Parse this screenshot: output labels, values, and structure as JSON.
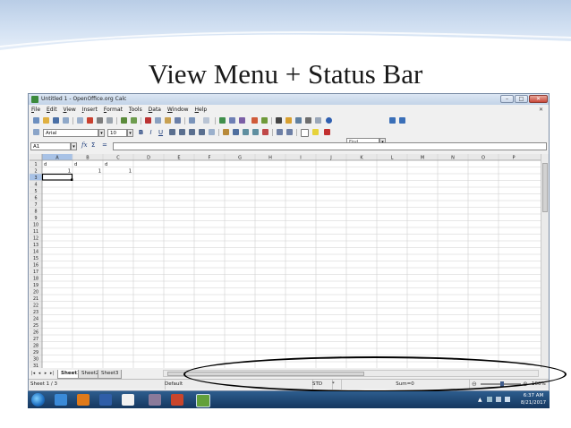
{
  "slide": {
    "title": "View Menu + Status Bar"
  },
  "window": {
    "title": "Untitled 1 - OpenOffice.org Calc",
    "min_label": "–",
    "max_label": "□",
    "close_label": "✕"
  },
  "menu": {
    "items": [
      "File",
      "Edit",
      "View",
      "Insert",
      "Format",
      "Tools",
      "Data",
      "Window",
      "Help"
    ],
    "close_x": "✕"
  },
  "toolbar": {
    "find_placeholder": "Find",
    "font_name": "Arial",
    "font_size": "10",
    "bold": "B",
    "italic": "I",
    "underline": "U"
  },
  "formula_bar": {
    "cell_ref": "A1",
    "fx": "fx",
    "sum": "Σ",
    "equals": "="
  },
  "sheet": {
    "columns": [
      "A",
      "B",
      "C",
      "D",
      "E",
      "F",
      "G",
      "H",
      "I",
      "J",
      "K",
      "L",
      "M",
      "N",
      "O",
      "P"
    ],
    "row_count": 31,
    "active_row": 3,
    "cells": [
      {
        "row": 1,
        "col": 0,
        "value": "d",
        "align": "left"
      },
      {
        "row": 1,
        "col": 1,
        "value": "d",
        "align": "left"
      },
      {
        "row": 1,
        "col": 2,
        "value": "d",
        "align": "left"
      },
      {
        "row": 2,
        "col": 0,
        "value": "1",
        "align": "right"
      },
      {
        "row": 2,
        "col": 1,
        "value": "1",
        "align": "right"
      },
      {
        "row": 2,
        "col": 2,
        "value": "1",
        "align": "right"
      }
    ]
  },
  "tabs": {
    "sheets": [
      "Sheet1",
      "Sheet2",
      "Sheet3"
    ],
    "active": "Sheet1"
  },
  "statusbar": {
    "sheet_info": "Sheet 1 / 3",
    "page_style": "Default",
    "mode": "STD",
    "mode_marker": "*",
    "sum": "Sum=0",
    "zoom": "100%"
  },
  "taskbar": {
    "time": "6:37 AM",
    "date": "8/21/2017"
  },
  "colors": {
    "selection": "#c3d6ef",
    "active_header": "#a8c2e6",
    "taskbar": "#1f4a78"
  }
}
